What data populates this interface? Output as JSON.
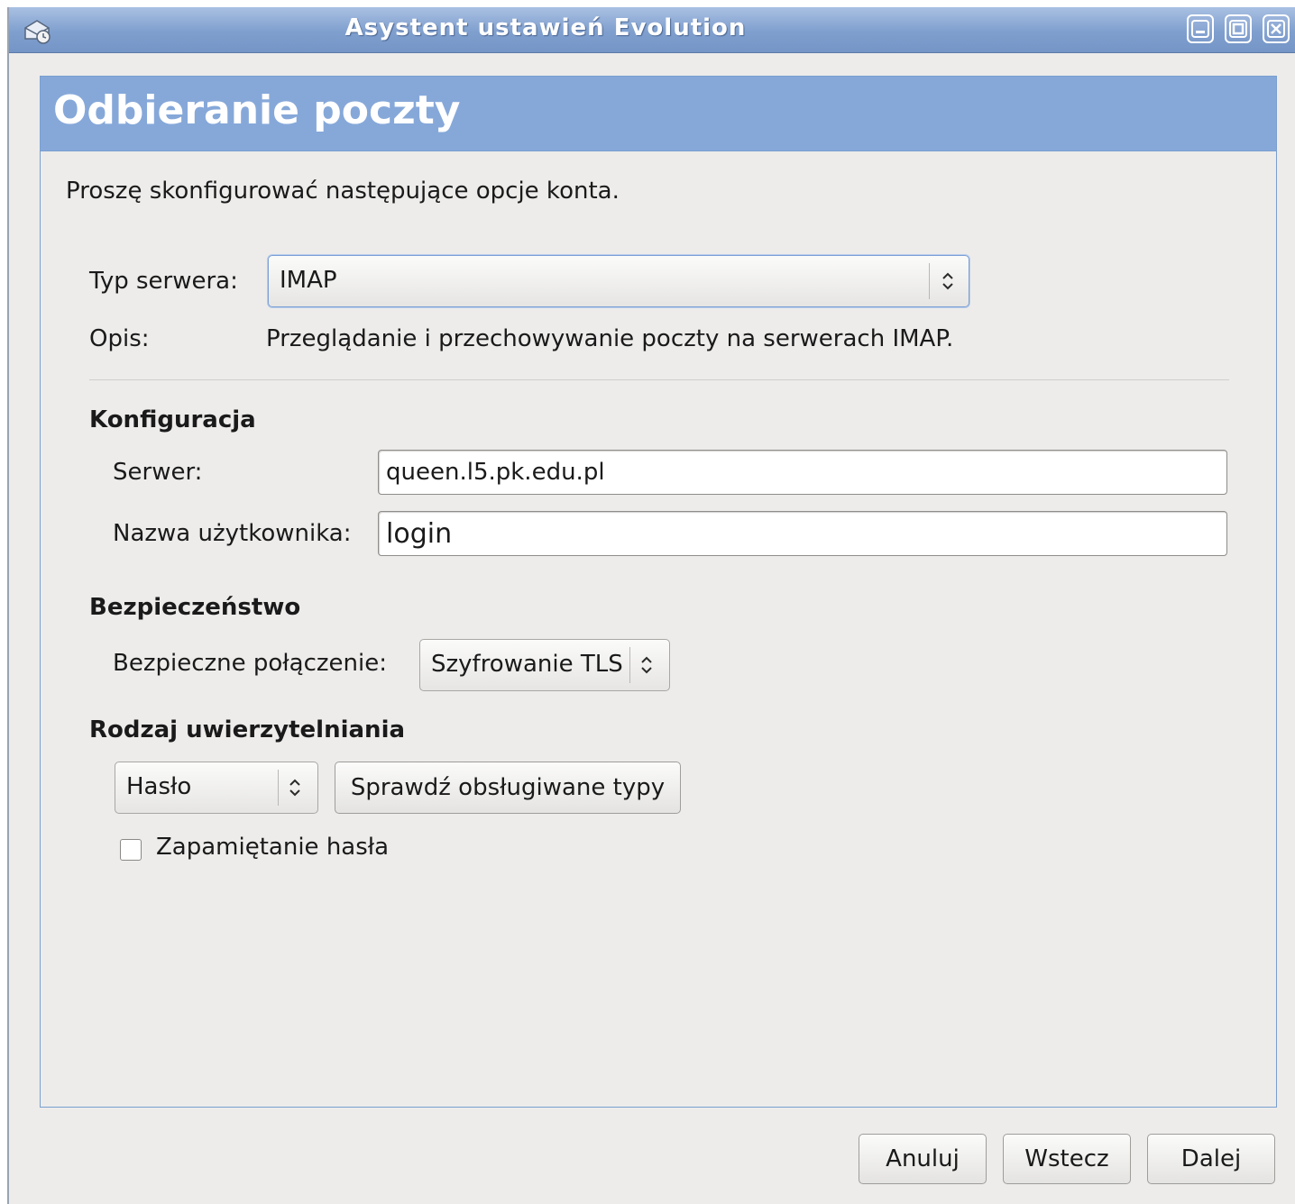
{
  "window": {
    "title": "Asystent ustawień Evolution",
    "buttons": [
      "minimize",
      "maximize",
      "close"
    ]
  },
  "page": {
    "heading": "Odbieranie poczty",
    "intro": "Proszę skonfigurować następujące opcje konta."
  },
  "server_type": {
    "label": "Typ serwera:",
    "value": "IMAP",
    "desc_label": "Opis:",
    "description": "Przeglądanie i przechowywanie poczty na serwerach IMAP."
  },
  "config": {
    "heading": "Konfiguracja",
    "server_label": "Serwer:",
    "server_value": "queen.l5.pk.edu.pl",
    "user_label": "Nazwa użytkownika:",
    "user_value": "login"
  },
  "security": {
    "heading": "Bezpieczeństwo",
    "conn_label": "Bezpieczne połączenie:",
    "conn_value": "Szyfrowanie TLS"
  },
  "auth": {
    "heading": "Rodzaj uwierzytelniania",
    "method": "Hasło",
    "check_button": "Sprawdź obsługiwane typy",
    "remember_label": "Zapamiętanie hasła",
    "remember_checked": false
  },
  "footer": {
    "cancel": "Anuluj",
    "back": "Wstecz",
    "next": "Dalej"
  },
  "colors": {
    "titlebar": "#7f9fce",
    "header_band": "#86a8d9",
    "background": "#edeceb"
  }
}
